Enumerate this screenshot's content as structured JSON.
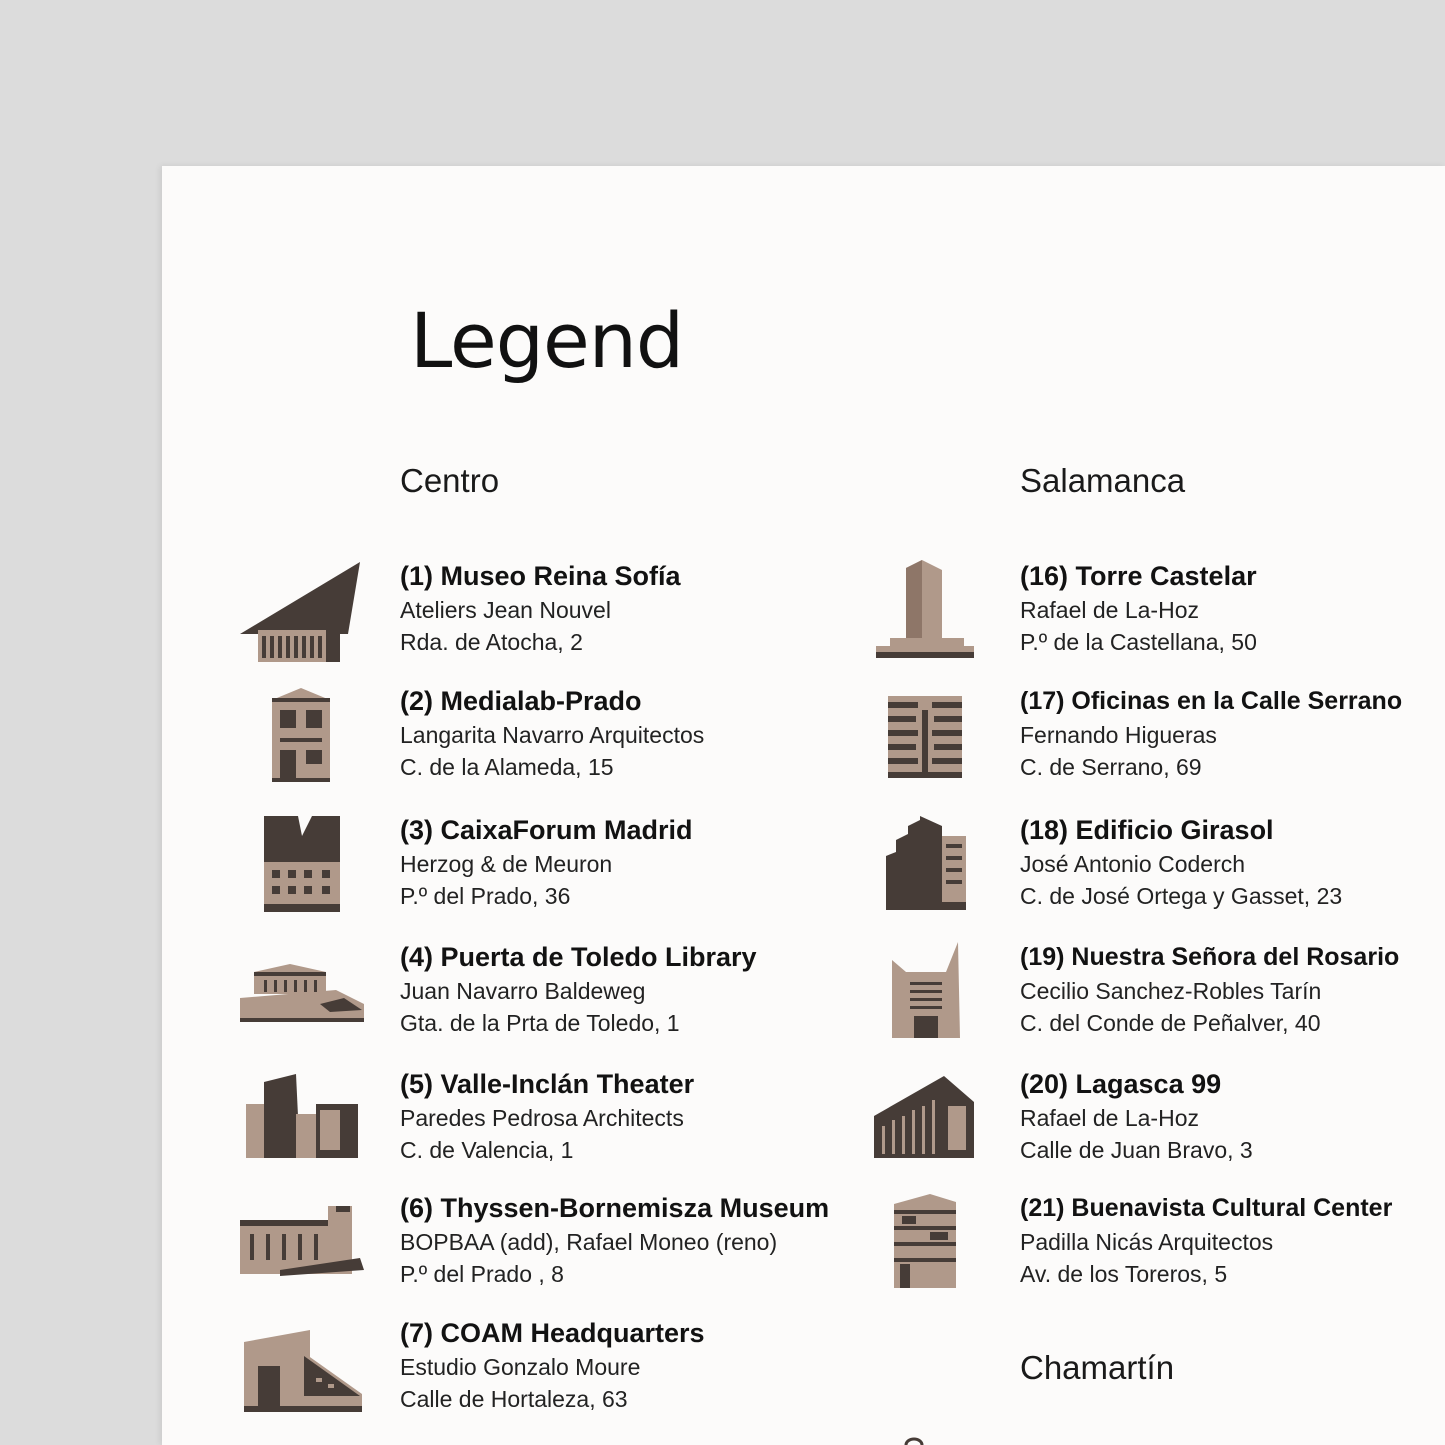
{
  "title": "Legend",
  "colors": {
    "brown": "#b0998a",
    "dark": "#463c37",
    "paper": "#fcfbfa",
    "background": "#dcdcdc"
  },
  "sections": {
    "centro": "Centro",
    "salamanca": "Salamanca",
    "chamartin": "Chamartín"
  },
  "centro": [
    {
      "name": "(1) Museo Reina Sofía",
      "architect": "Ateliers Jean Nouvel",
      "address": "Rda. de Atocha, 2",
      "icon": "reina-sofia-building-icon"
    },
    {
      "name": "(2) Medialab-Prado",
      "architect": "Langarita Navarro Arquitectos",
      "address": "C. de la Alameda, 15",
      "icon": "medialab-building-icon"
    },
    {
      "name": "(3) CaixaForum Madrid",
      "architect": "Herzog & de Meuron",
      "address": "P.º del Prado, 36",
      "icon": "caixaforum-building-icon"
    },
    {
      "name": "(4) Puerta de Toledo Library",
      "architect": "Juan Navarro Baldeweg",
      "address": "Gta. de la Prta de Toledo, 1",
      "icon": "library-building-icon"
    },
    {
      "name": "(5) Valle-Inclán Theater",
      "architect": "Paredes Pedrosa Architects",
      "address": "C. de Valencia, 1",
      "icon": "theater-building-icon"
    },
    {
      "name": "(6) Thyssen-Bornemisza Museum",
      "architect": "BOPBAA (add), Rafael Moneo (reno)",
      "address": "P.º del Prado  , 8",
      "icon": "thyssen-building-icon"
    },
    {
      "name": "(7) COAM Headquarters",
      "architect": "Estudio Gonzalo Moure",
      "address": "Calle de Hortaleza, 63",
      "icon": "coam-building-icon"
    }
  ],
  "salamanca": [
    {
      "name": "(16) Torre Castelar",
      "architect": "Rafael de La-Hoz",
      "address": "P.º de la Castellana, 50",
      "icon": "torre-castelar-building-icon"
    },
    {
      "name": "(17) Oficinas en la Calle Serrano",
      "architect": "Fernando Higueras",
      "address": "C. de Serrano, 69",
      "icon": "serrano-offices-building-icon"
    },
    {
      "name": "(18) Edificio Girasol",
      "architect": "José Antonio Coderch",
      "address": "C. de José Ortega y Gasset, 23",
      "icon": "girasol-building-icon"
    },
    {
      "name": "(19) Nuestra Señora del Rosario",
      "architect": "Cecilio Sanchez-Robles Tarín",
      "address": "C. del Conde de Peñalver, 40",
      "icon": "rosario-church-icon"
    },
    {
      "name": "(20) Lagasca 99",
      "architect": "Rafael de La-Hoz",
      "address": "Calle de Juan Bravo, 3",
      "icon": "lagasca-building-icon"
    },
    {
      "name": "(21) Buenavista Cultural Center",
      "architect": "Padilla Nicás Arquitectos",
      "address": "Av. de los Toreros, 5",
      "icon": "buenavista-building-icon"
    }
  ]
}
